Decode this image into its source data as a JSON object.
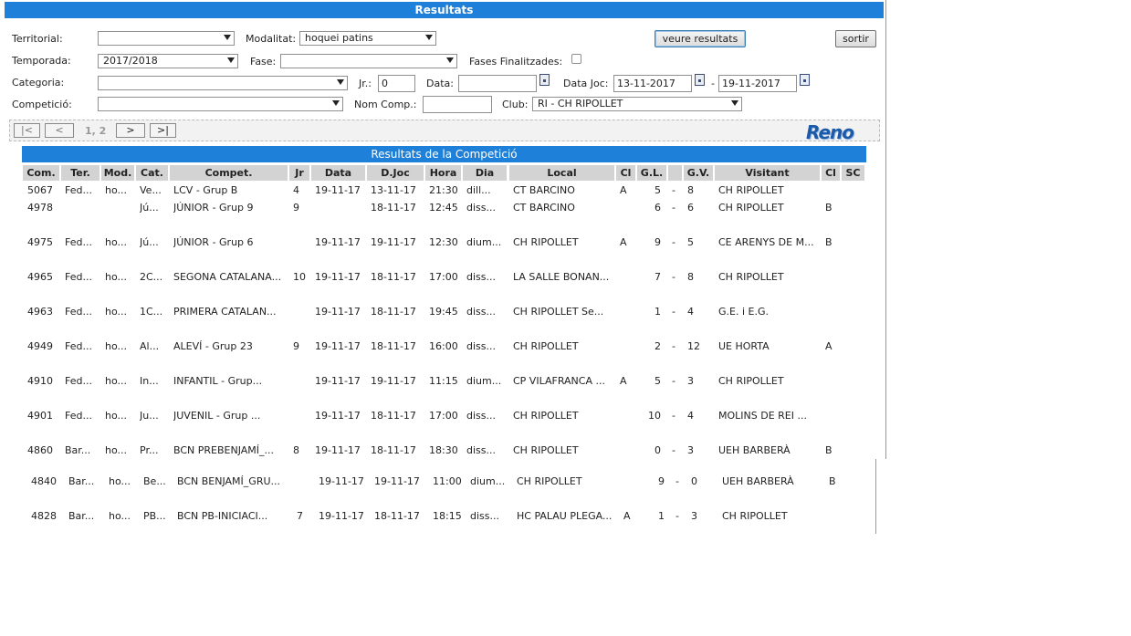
{
  "title": "Resultats",
  "filters": {
    "territorial_label": "Territorial:",
    "territorial_value": "",
    "modalitat_label": "Modalitat:",
    "modalitat_value": "hoquei patins",
    "temporada_label": "Temporada:",
    "temporada_value": "2017/2018",
    "fase_label": "Fase:",
    "fase_value": "",
    "fases_finalitzades_label": "Fases Finalitzades:",
    "categoria_label": "Categoria:",
    "categoria_value": "",
    "jr_label": "Jr.:",
    "jr_value": "0",
    "data_label": "Data:",
    "data_value": "",
    "data_joc_label": "Data Joc:",
    "data_joc_from": "13-11-2017",
    "data_joc_sep": "-",
    "data_joc_to": "19-11-2017",
    "competicio_label": "Competició:",
    "competicio_value": "",
    "nom_comp_label": "Nom Comp.:",
    "nom_comp_value": "",
    "club_label": "Club:",
    "club_value": "RI - CH RIPOLLET",
    "veure_button": "veure resultats",
    "sortir_button": "sortir"
  },
  "pager": {
    "first": "|<",
    "prev": "<",
    "pages": "1, 2",
    "next": ">",
    "last": ">|",
    "logo": "Reno"
  },
  "results_title": "Resultats de la Competició",
  "columns": [
    "Com.",
    "Ter.",
    "Mod.",
    "Cat.",
    "Compet.",
    "Jr",
    "Data",
    "D.Joc",
    "Hora",
    "Dia",
    "Local",
    "Cl",
    "G.L.",
    "",
    "G.V.",
    "Visitant",
    "Cl",
    "SC"
  ],
  "rows": [
    {
      "com": "5067",
      "ter": "Fed...",
      "mod": "ho...",
      "cat": "Ve...",
      "compet": "LCV - Grup B",
      "jr": "4",
      "data": "19-11-17",
      "djoc": "13-11-17",
      "hora": "21:30",
      "dia": "dill...",
      "local": "CT BARCINO",
      "cl": "A",
      "gl": "5",
      "sep": "-",
      "gv": "8",
      "visitant": "CH RIPOLLET",
      "cl2": "",
      "sc": ""
    },
    {
      "com": "4978",
      "ter": "",
      "mod": "",
      "cat": "Jú...",
      "compet": "JÚNIOR - Grup 9",
      "jr": "9",
      "data": "",
      "djoc": "18-11-17",
      "hora": "12:45",
      "dia": "diss...",
      "local": "CT BARCINO",
      "cl": "",
      "gl": "6",
      "sep": "-",
      "gv": "6",
      "visitant": "CH RIPOLLET",
      "cl2": "B",
      "sc": ""
    },
    {
      "com": "4975",
      "ter": "Fed...",
      "mod": "ho...",
      "cat": "Jú...",
      "compet": "JÚNIOR - Grup 6",
      "jr": "",
      "data": "19-11-17",
      "djoc": "19-11-17",
      "hora": "12:30",
      "dia": "dium...",
      "local": "CH RIPOLLET",
      "cl": "A",
      "gl": "9",
      "sep": "-",
      "gv": "5",
      "visitant": "CE ARENYS DE M...",
      "cl2": "B",
      "sc": ""
    },
    {
      "com": "4965",
      "ter": "Fed...",
      "mod": "ho...",
      "cat": "2C...",
      "compet": "SEGONA CATALANA...",
      "jr": "10",
      "data": "19-11-17",
      "djoc": "18-11-17",
      "hora": "17:00",
      "dia": "diss...",
      "local": "LA SALLE BONAN...",
      "cl": "",
      "gl": "7",
      "sep": "-",
      "gv": "8",
      "visitant": "CH RIPOLLET",
      "cl2": "",
      "sc": ""
    },
    {
      "com": "4963",
      "ter": "Fed...",
      "mod": "ho...",
      "cat": "1C...",
      "compet": "PRIMERA CATALAN...",
      "jr": "",
      "data": "19-11-17",
      "djoc": "18-11-17",
      "hora": "19:45",
      "dia": "diss...",
      "local": "CH RIPOLLET Se...",
      "cl": "",
      "gl": "1",
      "sep": "-",
      "gv": "4",
      "visitant": "G.E. i E.G.",
      "cl2": "",
      "sc": ""
    },
    {
      "com": "4949",
      "ter": "Fed...",
      "mod": "ho...",
      "cat": "Al...",
      "compet": "ALEVÍ - Grup 23",
      "jr": "9",
      "data": "19-11-17",
      "djoc": "18-11-17",
      "hora": "16:00",
      "dia": "diss...",
      "local": "CH RIPOLLET",
      "cl": "",
      "gl": "2",
      "sep": "-",
      "gv": "12",
      "visitant": "UE HORTA",
      "cl2": "A",
      "sc": ""
    },
    {
      "com": "4910",
      "ter": "Fed...",
      "mod": "ho...",
      "cat": "In...",
      "compet": "INFANTIL - Grup...",
      "jr": "",
      "data": "19-11-17",
      "djoc": "19-11-17",
      "hora": "11:15",
      "dia": "dium...",
      "local": "CP VILAFRANCA ...",
      "cl": "A",
      "gl": "5",
      "sep": "-",
      "gv": "3",
      "visitant": "CH RIPOLLET",
      "cl2": "",
      "sc": ""
    },
    {
      "com": "4901",
      "ter": "Fed...",
      "mod": "ho...",
      "cat": "Ju...",
      "compet": "JUVENIL - Grup ...",
      "jr": "",
      "data": "19-11-17",
      "djoc": "18-11-17",
      "hora": "17:00",
      "dia": "diss...",
      "local": "CH RIPOLLET",
      "cl": "",
      "gl": "10",
      "sep": "-",
      "gv": "4",
      "visitant": "MOLINS DE REI ...",
      "cl2": "",
      "sc": ""
    },
    {
      "com": "4860",
      "ter": "Bar...",
      "mod": "ho...",
      "cat": "Pr...",
      "compet": "BCN PREBENJAMÍ_...",
      "jr": "8",
      "data": "19-11-17",
      "djoc": "18-11-17",
      "hora": "18:30",
      "dia": "diss...",
      "local": "CH RIPOLLET",
      "cl": "",
      "gl": "0",
      "sep": "-",
      "gv": "3",
      "visitant": "UEH BARBERÀ",
      "cl2": "B",
      "sc": ""
    },
    {
      "com": "4840",
      "ter": "Bar...",
      "mod": "ho...",
      "cat": "Be...",
      "compet": "BCN BENJAMÍ_GRU...",
      "jr": "",
      "data": "19-11-17",
      "djoc": "19-11-17",
      "hora": "11:00",
      "dia": "dium...",
      "local": "CH RIPOLLET",
      "cl": "",
      "gl": "9",
      "sep": "-",
      "gv": "0",
      "visitant": "UEH BARBERÀ",
      "cl2": "B",
      "sc": ""
    },
    {
      "com": "4828",
      "ter": "Bar...",
      "mod": "ho...",
      "cat": "PB...",
      "compet": "BCN PB-INICIACI...",
      "jr": "7",
      "data": "19-11-17",
      "djoc": "18-11-17",
      "hora": "18:15",
      "dia": "diss...",
      "local": "HC PALAU PLEGA...",
      "cl": "A",
      "gl": "1",
      "sep": "-",
      "gv": "3",
      "visitant": "CH RIPOLLET",
      "cl2": "",
      "sc": ""
    }
  ]
}
